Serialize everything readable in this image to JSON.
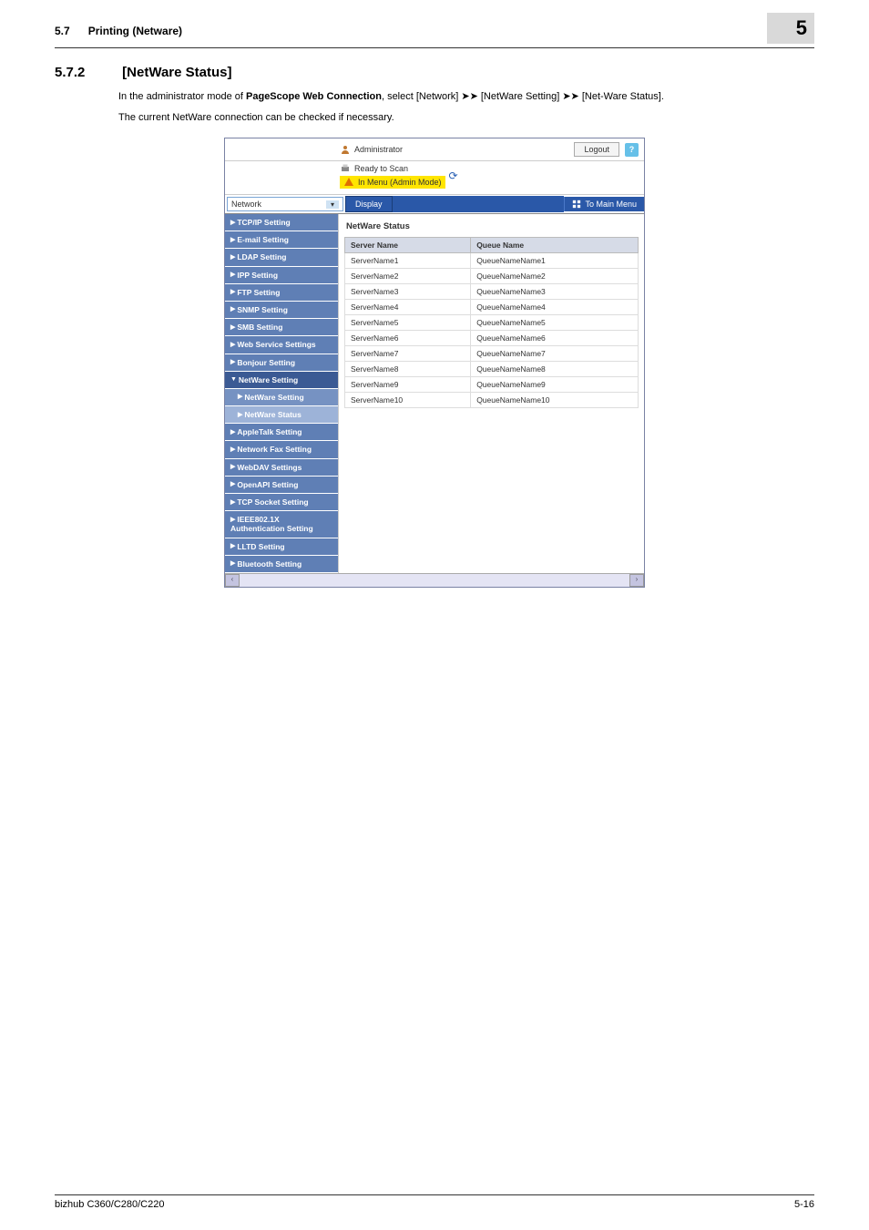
{
  "header": {
    "section_num": "5.7",
    "section_title": "Printing (Netware)",
    "chapter_num": "5"
  },
  "section": {
    "num": "5.7.2",
    "title": "[NetWare Status]"
  },
  "paragraphs": {
    "p1_a": "In the administrator mode of ",
    "p1_b": "PageScope Web Connection",
    "p1_c": ", select [Network] ",
    "p1_d": " [NetWare Setting] ",
    "p1_e": " [Net-Ware Status].",
    "p2": "The current NetWare connection can be checked if necessary."
  },
  "ui": {
    "top": {
      "admin_label": "Administrator",
      "logout": "Logout",
      "help": "?"
    },
    "status": {
      "ready": "Ready to Scan",
      "menu_mode": "In Menu (Admin Mode)"
    },
    "navbar": {
      "select_value": "Network",
      "display": "Display",
      "to_main": "To Main Menu"
    },
    "sidebar": [
      {
        "label": "TCP/IP Setting",
        "type": "item"
      },
      {
        "label": "E-mail Setting",
        "type": "item"
      },
      {
        "label": "LDAP Setting",
        "type": "item"
      },
      {
        "label": "IPP Setting",
        "type": "item"
      },
      {
        "label": "FTP Setting",
        "type": "item"
      },
      {
        "label": "SNMP Setting",
        "type": "item"
      },
      {
        "label": "SMB Setting",
        "type": "item"
      },
      {
        "label": "Web Service Settings",
        "type": "item"
      },
      {
        "label": "Bonjour Setting",
        "type": "item"
      },
      {
        "label": "NetWare Setting",
        "type": "group"
      },
      {
        "label": "NetWare Setting",
        "type": "sub"
      },
      {
        "label": "NetWare Status",
        "type": "sub-active"
      },
      {
        "label": "AppleTalk Setting",
        "type": "item"
      },
      {
        "label": "Network Fax Setting",
        "type": "item"
      },
      {
        "label": "WebDAV Settings",
        "type": "item"
      },
      {
        "label": "OpenAPI Setting",
        "type": "item"
      },
      {
        "label": "TCP Socket Setting",
        "type": "item"
      },
      {
        "label": "IEEE802.1X Authentication Setting",
        "type": "item"
      },
      {
        "label": "LLTD Setting",
        "type": "item"
      },
      {
        "label": "Bluetooth Setting",
        "type": "item"
      }
    ],
    "main": {
      "title": "NetWare Status",
      "col1": "Server Name",
      "col2": "Queue Name",
      "rows": [
        {
          "s": "ServerName1",
          "q": "QueueNameName1"
        },
        {
          "s": "ServerName2",
          "q": "QueueNameName2"
        },
        {
          "s": "ServerName3",
          "q": "QueueNameName3"
        },
        {
          "s": "ServerName4",
          "q": "QueueNameName4"
        },
        {
          "s": "ServerName5",
          "q": "QueueNameName5"
        },
        {
          "s": "ServerName6",
          "q": "QueueNameName6"
        },
        {
          "s": "ServerName7",
          "q": "QueueNameName7"
        },
        {
          "s": "ServerName8",
          "q": "QueueNameName8"
        },
        {
          "s": "ServerName9",
          "q": "QueueNameName9"
        },
        {
          "s": "ServerName10",
          "q": "QueueNameName10"
        }
      ]
    }
  },
  "footer": {
    "left": "bizhub C360/C280/C220",
    "right": "5-16"
  }
}
